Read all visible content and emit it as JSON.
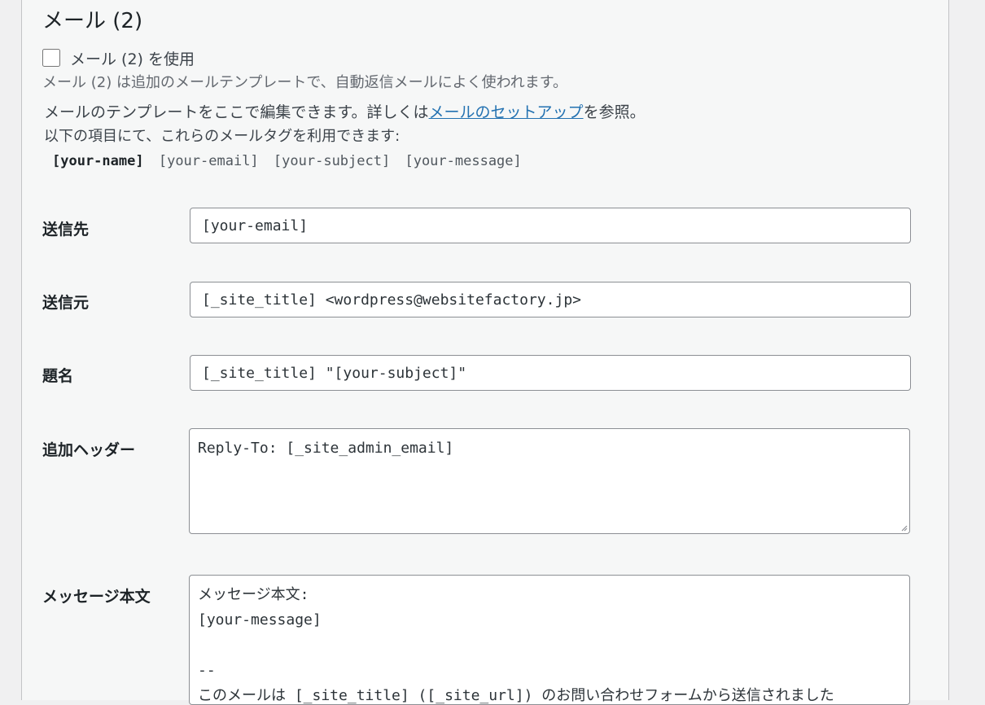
{
  "section": {
    "title": "メール (2)",
    "use_label": "メール (2) を使用",
    "description": "メール (2) は追加のメールテンプレートで、自動返信メールによく使われます。"
  },
  "help": {
    "line1_before": "メールのテンプレートをここで編集できます。詳しくは",
    "line1_link": "メールのセットアップ",
    "line1_after": "を参照。",
    "line2": "以下の項目にて、これらのメールタグを利用できます:",
    "tags": [
      {
        "text": "[your-name]",
        "used": true
      },
      {
        "text": "[your-email]",
        "used": false
      },
      {
        "text": "[your-subject]",
        "used": false
      },
      {
        "text": "[your-message]",
        "used": false
      }
    ]
  },
  "fields": {
    "to": {
      "label": "送信先",
      "value": "[your-email]"
    },
    "from": {
      "label": "送信元",
      "value": "[_site_title] <wordpress@websitefactory.jp>"
    },
    "subject": {
      "label": "題名",
      "value": "[_site_title] \"[your-subject]\""
    },
    "headers": {
      "label": "追加ヘッダー",
      "value": "Reply-To: [_site_admin_email]"
    },
    "body": {
      "label": "メッセージ本文",
      "value": "メッセージ本文:\n[your-message]\n\n--\nこのメールは [_site_title] ([_site_url]) のお問い合わせフォームから送信されました"
    }
  }
}
